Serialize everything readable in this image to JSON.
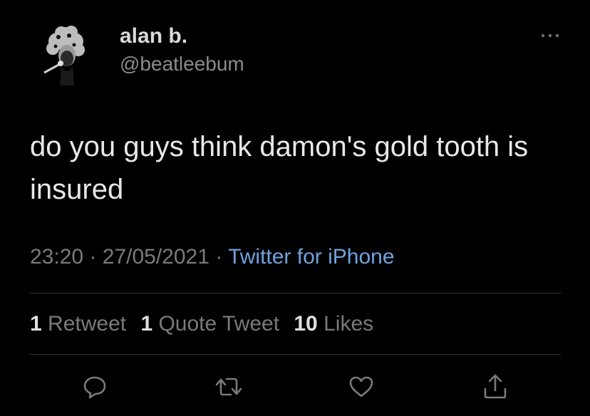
{
  "author": {
    "display_name": "alan b.",
    "handle": "@beatleebum"
  },
  "tweet": {
    "text": "do you guys think damon's gold tooth is insured",
    "time": "23:20",
    "separator": "·",
    "date": "27/05/2021",
    "source": "Twitter for iPhone"
  },
  "stats": {
    "retweets_count": "1",
    "retweets_label": "Retweet",
    "quotes_count": "1",
    "quotes_label": "Quote Tweet",
    "likes_count": "10",
    "likes_label": "Likes"
  },
  "icons": {
    "more": "more-horizontal-icon",
    "reply": "reply-bubble-icon",
    "retweet": "retweet-icon",
    "like": "heart-icon",
    "share": "share-icon"
  },
  "colors": {
    "background": "#000000",
    "text": "#e8e8e8",
    "secondary": "#7a7a7a",
    "link": "#6fa3df",
    "divider": "#2e2e2e"
  }
}
